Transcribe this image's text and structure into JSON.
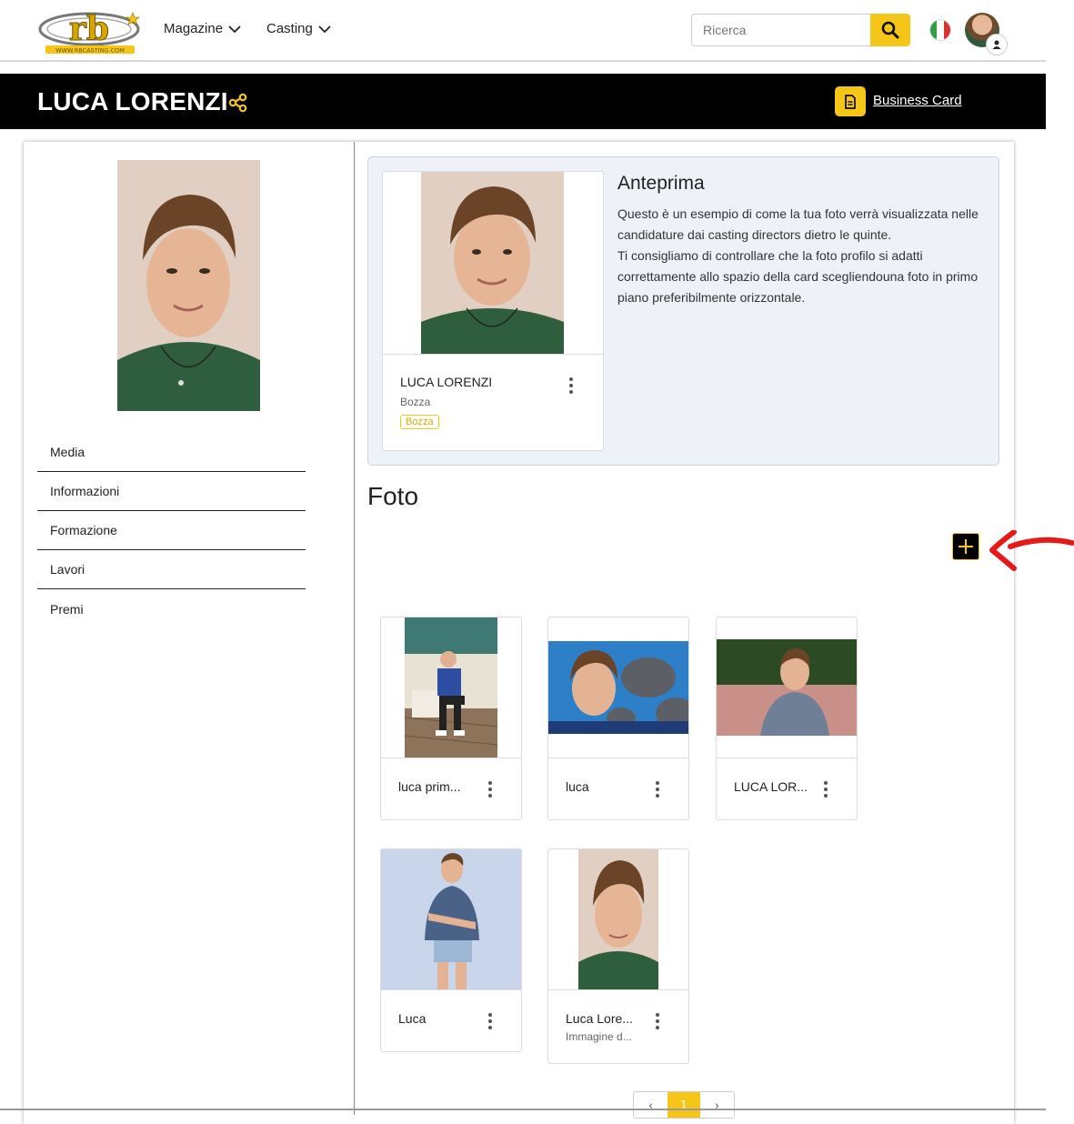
{
  "header": {
    "logo_text": "rb",
    "logo_caption": "WWW.RBCASTING.COM",
    "nav": [
      {
        "label": "Magazine"
      },
      {
        "label": "Casting"
      }
    ],
    "search": {
      "placeholder": "Ricerca",
      "value": ""
    },
    "language": "it",
    "colors": {
      "accent": "#f5c518",
      "hero_bg": "#000000"
    }
  },
  "profile": {
    "name": "LUCA LORENZI",
    "business_card_label": "Business Card"
  },
  "sidebar": {
    "items": [
      {
        "label": "Media"
      },
      {
        "label": "Informazioni"
      },
      {
        "label": "Formazione"
      },
      {
        "label": "Lavori"
      },
      {
        "label": "Premi"
      }
    ]
  },
  "preview": {
    "title": "Anteprima",
    "description_line1": "Questo è un esempio di come la tua foto verrà visualizzata nelle candidature dai casting directors dietro le quinte.",
    "description_line2": "Ti consigliamo di controllare che la foto profilo si adatti correttamente allo spazio della card scegliendouna foto in primo piano preferibilmente orizzontale.",
    "card": {
      "name": "LUCA LORENZI",
      "subtitle": "Bozza",
      "badge": "Bozza"
    }
  },
  "photos": {
    "section_title": "Foto",
    "items": [
      {
        "name": "luca prim...",
        "sub": ""
      },
      {
        "name": "luca",
        "sub": ""
      },
      {
        "name": "LUCA LOR...",
        "sub": ""
      },
      {
        "name": "Luca",
        "sub": ""
      },
      {
        "name": "Luca Lore...",
        "sub": "Immagine d..."
      }
    ]
  },
  "pagination": {
    "prev": "‹",
    "current": "1",
    "next": "›"
  }
}
